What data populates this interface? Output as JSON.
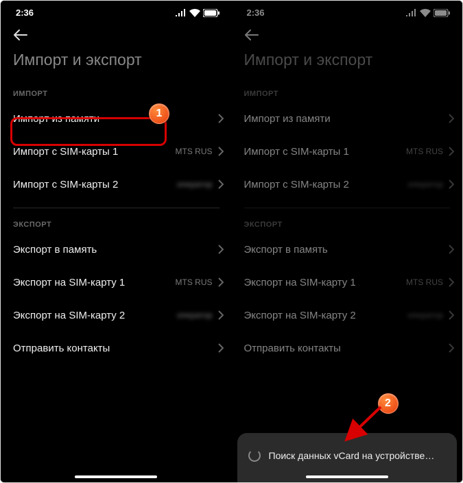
{
  "status": {
    "time": "2:36"
  },
  "title": "Импорт и экспорт",
  "sections": {
    "import_label": "ИМПОРТ",
    "export_label": "ЭКСПОРТ"
  },
  "rows": {
    "import_mem": "Импорт из памяти",
    "import_sim1": "Импорт с SIM-карты 1",
    "import_sim2": "Импорт с SIM-карты 2",
    "export_mem": "Экспорт в память",
    "export_sim1": "Экспорт на SIM-карту 1",
    "export_sim2": "Экспорт на SIM-карту 2",
    "send": "Отправить контакты",
    "sim1_op": "MTS RUS",
    "sim2_op": "оператор"
  },
  "toast": "Поиск данных vCard на устройстве…",
  "badges": {
    "one": "1",
    "two": "2"
  }
}
